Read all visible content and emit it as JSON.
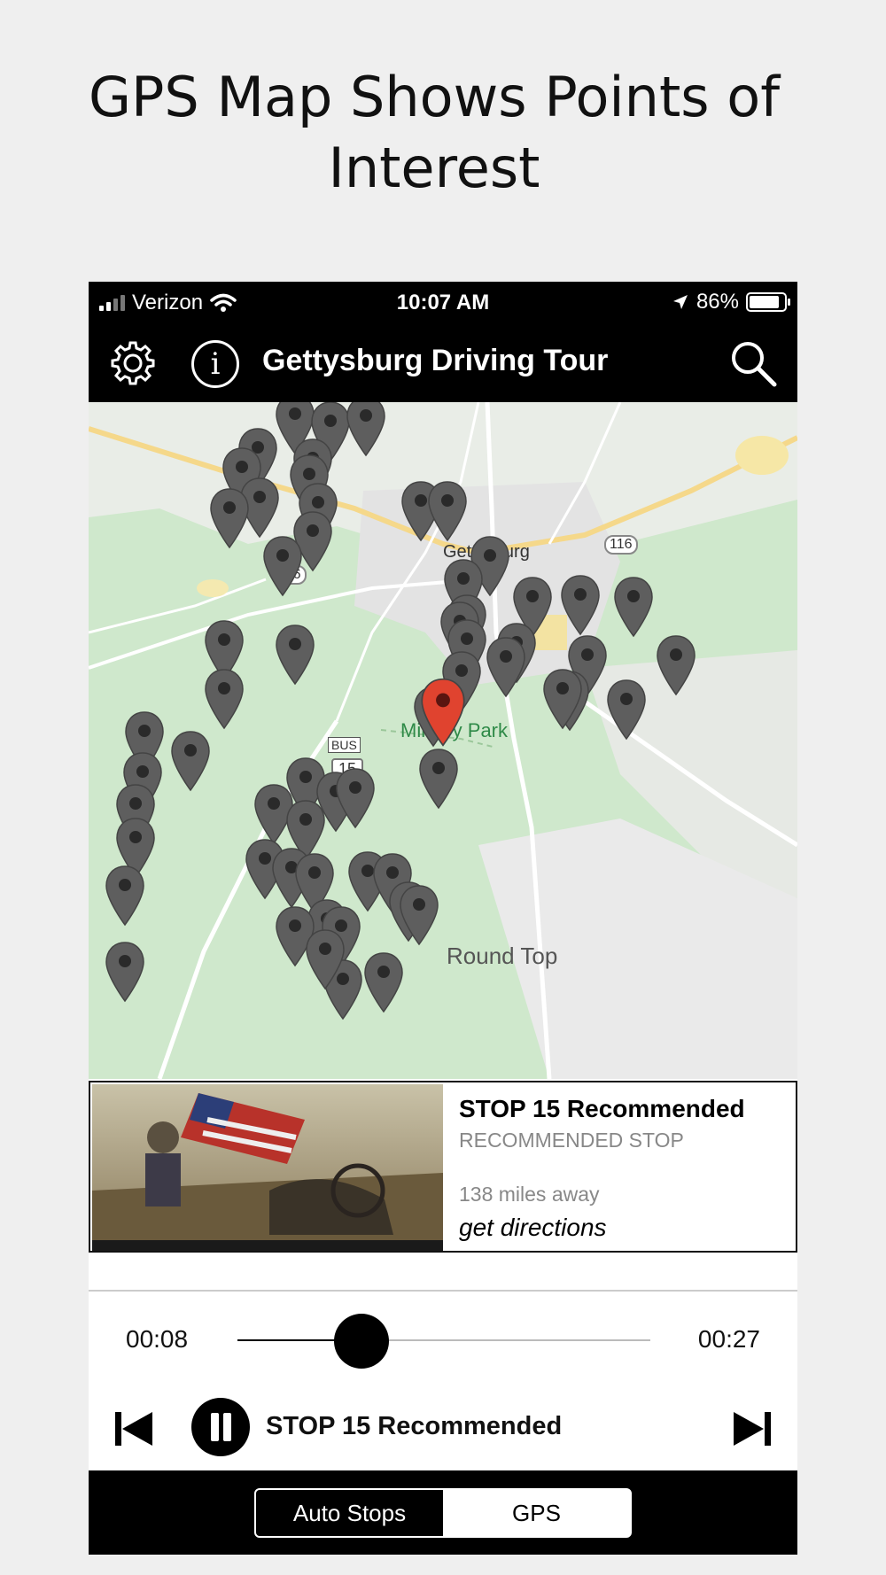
{
  "headline": {
    "line1": "GPS Map Shows Points of",
    "line2": "Interest"
  },
  "status_bar": {
    "carrier": "Verizon",
    "time": "10:07 AM",
    "battery": "86%",
    "battery_level": 0.86
  },
  "nav_bar": {
    "title": "Gettysburg Driving Tour",
    "icons": [
      "gear-icon",
      "info-icon",
      "search-icon"
    ],
    "info_glyph": "i"
  },
  "map": {
    "labels": {
      "town": "Gettysburg",
      "route_116_a": "116",
      "route_116_b": "116",
      "route_bus": "BUS",
      "route_15": "15",
      "park": "Military Park",
      "round_top": "Round Top"
    },
    "pin_color": "#5e5e5e",
    "selected_pin_color": "#e0432f"
  },
  "stop_card": {
    "title": "STOP 15 Recommended",
    "subtitle": "RECOMMENDED STOP",
    "distance": "138 miles away",
    "directions": "get directions"
  },
  "player": {
    "current_time": "00:08",
    "duration": "00:27",
    "progress": 0.3,
    "now_playing": "STOP 15 Recommended"
  },
  "segmented": {
    "options": [
      "Auto Stops",
      "GPS"
    ],
    "selected": "Auto Stops"
  }
}
